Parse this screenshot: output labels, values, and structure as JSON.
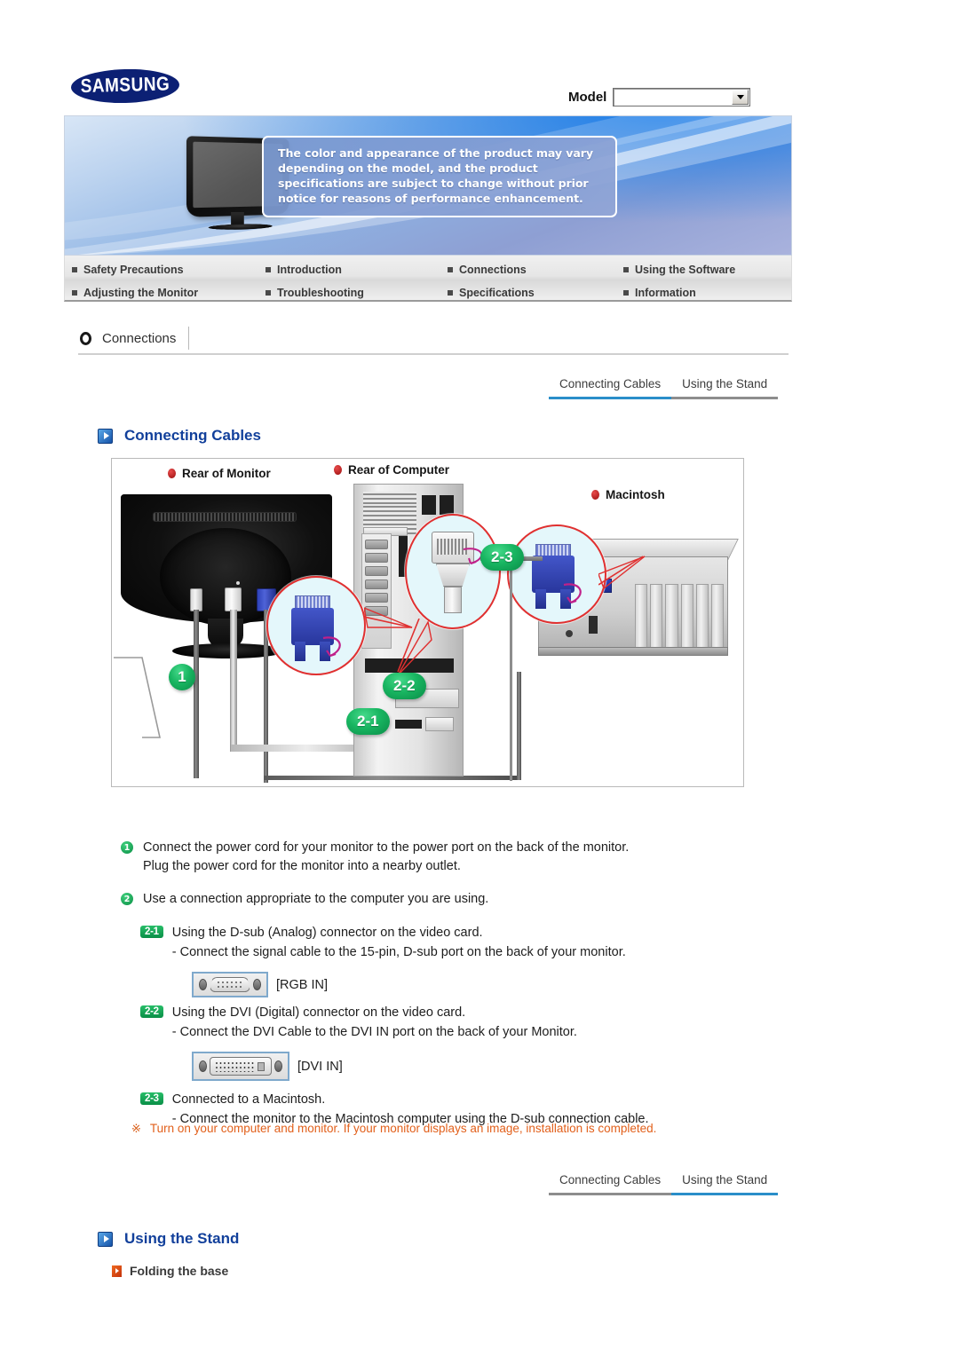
{
  "brand": {
    "logo_text": "SAMSUNG"
  },
  "header": {
    "model_label": "Model",
    "model_value": "",
    "model_placeholder": "",
    "notice": "The color and appearance of the product may vary depending on the model, and the product specifications are subject to change without prior notice for reasons of performance enhancement."
  },
  "nav": {
    "items": [
      {
        "label": "Safety Precautions"
      },
      {
        "label": "Introduction"
      },
      {
        "label": "Connections"
      },
      {
        "label": "Using the Software"
      },
      {
        "label": "Adjusting the Monitor"
      },
      {
        "label": "Troubleshooting"
      },
      {
        "label": "Specifications"
      },
      {
        "label": "Information"
      }
    ]
  },
  "breadcrumb": {
    "label": "Connections"
  },
  "tabs_top": [
    {
      "label": "Connecting Cables",
      "active": true
    },
    {
      "label": "Using the Stand",
      "active": false
    }
  ],
  "tabs_bottom": [
    {
      "label": "Connecting Cables",
      "active": false
    },
    {
      "label": "Using the Stand",
      "active": true
    }
  ],
  "section_connecting": {
    "title": "Connecting Cables"
  },
  "section_stand": {
    "title": "Using the Stand",
    "sub_title": "Folding the base"
  },
  "diagram": {
    "label_monitor": "Rear of Monitor",
    "label_computer": "Rear of Computer",
    "label_macintosh": "Macintosh",
    "badge_1": "1",
    "badge_2_1": "2-1",
    "badge_2_2": "2-2",
    "badge_2_3": "2-3"
  },
  "instructions": {
    "step1": {
      "number": "1",
      "line1": "Connect the power cord for your monitor to the power port on the back of the monitor.",
      "line2": "Plug the power cord for the monitor into a nearby outlet."
    },
    "step2": {
      "number": "2",
      "line1": "Use a connection appropriate to the computer you are using."
    },
    "step2_1": {
      "badge": "2-1",
      "line1": "Using the D-sub (Analog) connector on the video card.",
      "line2": "- Connect the signal cable to the 15-pin, D-sub port on the back of your monitor.",
      "port_caption": "[RGB IN]"
    },
    "step2_2": {
      "badge": "2-2",
      "line1": "Using the DVI (Digital) connector on the video card.",
      "line2": "- Connect the DVI Cable to the DVI IN port on the back of your Monitor.",
      "port_caption": "[DVI IN]"
    },
    "step2_3": {
      "badge": "2-3",
      "line1": "Connected to a Macintosh.",
      "line2": "- Connect the monitor to the Macintosh computer using the D-sub connection cable."
    },
    "note": {
      "mark": "※",
      "text": "Turn on your computer and monitor. If your monitor displays an image, installation is completed."
    }
  },
  "colors": {
    "brand_blue": "#0c2074",
    "heading_blue": "#12409b",
    "tab_active": "#2a8ec9",
    "tab_inactive": "#8d8d8d",
    "badge_green": "#18b561",
    "note_orange": "#e2601b"
  }
}
